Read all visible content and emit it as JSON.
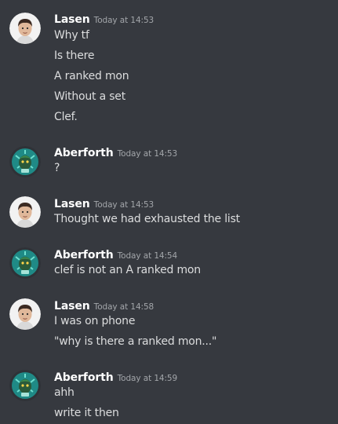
{
  "messages": [
    {
      "author": "Lasen",
      "timestamp": "Today at 14:53",
      "avatar_icon": "human-face-avatar",
      "lines": [
        "Why tf",
        "Is there",
        "A ranked mon",
        "Without a set",
        "Clef."
      ]
    },
    {
      "author": "Aberforth",
      "timestamp": "Today at 14:53",
      "avatar_icon": "green-creature-avatar",
      "lines": [
        "?"
      ]
    },
    {
      "author": "Lasen",
      "timestamp": "Today at 14:53",
      "avatar_icon": "human-face-avatar",
      "lines": [
        "Thought we had exhausted the list"
      ]
    },
    {
      "author": "Aberforth",
      "timestamp": "Today at 14:54",
      "avatar_icon": "green-creature-avatar",
      "lines": [
        "clef is not an A ranked mon"
      ]
    },
    {
      "author": "Lasen",
      "timestamp": "Today at 14:58",
      "avatar_icon": "human-face-avatar",
      "lines": [
        "I was on phone",
        "\"why is there a ranked mon...\""
      ]
    },
    {
      "author": "Aberforth",
      "timestamp": "Today at 14:59",
      "avatar_icon": "green-creature-avatar",
      "lines": [
        "ahh",
        "write it then"
      ]
    }
  ],
  "colors": {
    "background": "#36393f",
    "username": "#ffffff",
    "timestamp": "#a3a6aa",
    "message_text": "#dcddde"
  }
}
